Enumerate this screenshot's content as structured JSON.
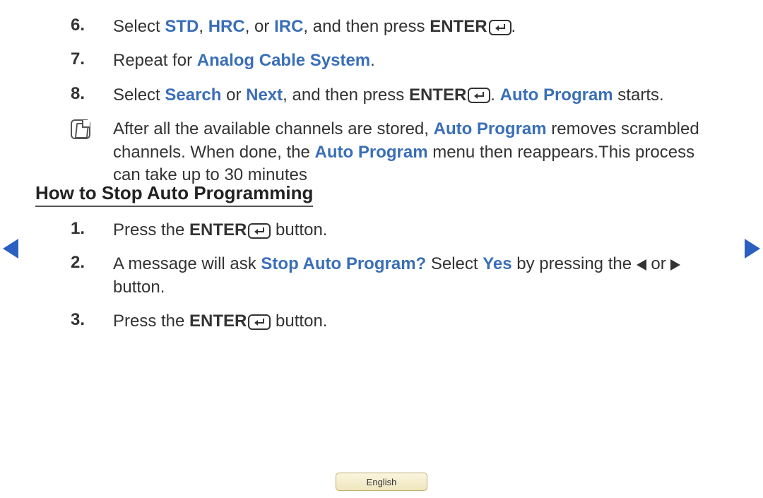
{
  "steps_a": [
    {
      "num": "6.",
      "parts": [
        {
          "t": "Select ",
          "c": ""
        },
        {
          "t": "STD",
          "c": "kw bold"
        },
        {
          "t": ", ",
          "c": ""
        },
        {
          "t": "HRC",
          "c": "kw bold"
        },
        {
          "t": ", or ",
          "c": ""
        },
        {
          "t": "IRC",
          "c": "kw bold"
        },
        {
          "t": ", and then press ",
          "c": ""
        },
        {
          "t": "ENTER",
          "c": "bold"
        },
        {
          "icon": "enter"
        },
        {
          "t": ".",
          "c": ""
        }
      ]
    },
    {
      "num": "7.",
      "parts": [
        {
          "t": "Repeat for ",
          "c": ""
        },
        {
          "t": "Analog Cable System",
          "c": "kw bold"
        },
        {
          "t": ".",
          "c": ""
        }
      ]
    },
    {
      "num": "8.",
      "parts": [
        {
          "t": "Select ",
          "c": ""
        },
        {
          "t": "Search",
          "c": "kw bold"
        },
        {
          "t": " or ",
          "c": ""
        },
        {
          "t": "Next",
          "c": "kw bold"
        },
        {
          "t": ", and then press ",
          "c": ""
        },
        {
          "t": "ENTER",
          "c": "bold"
        },
        {
          "icon": "enter"
        },
        {
          "t": ". ",
          "c": ""
        },
        {
          "t": "Auto Program",
          "c": "kw bold"
        },
        {
          "t": " starts.",
          "c": ""
        }
      ]
    }
  ],
  "note": {
    "parts": [
      {
        "t": "After all the available channels are stored, ",
        "c": ""
      },
      {
        "t": "Auto Program",
        "c": "kw bold"
      },
      {
        "t": " removes scrambled channels. When done, the ",
        "c": ""
      },
      {
        "t": "Auto Program",
        "c": "kw bold"
      },
      {
        "t": " menu then reappears.This process can take up to 30 minutes",
        "c": ""
      }
    ]
  },
  "heading": "How to Stop Auto Programming",
  "steps_b": [
    {
      "num": "1.",
      "parts": [
        {
          "t": "Press the ",
          "c": ""
        },
        {
          "t": "ENTER",
          "c": "bold"
        },
        {
          "icon": "enter"
        },
        {
          "t": " button.",
          "c": ""
        }
      ]
    },
    {
      "num": "2.",
      "parts": [
        {
          "t": "A message will ask ",
          "c": ""
        },
        {
          "t": "Stop Auto Program?",
          "c": "kw bold"
        },
        {
          "t": " Select ",
          "c": ""
        },
        {
          "t": "Yes",
          "c": "kw bold"
        },
        {
          "t": " by pressing the ",
          "c": ""
        },
        {
          "icon": "tri-left"
        },
        {
          "t": " or ",
          "c": ""
        },
        {
          "icon": "tri-right"
        },
        {
          "t": " button.",
          "c": ""
        }
      ]
    },
    {
      "num": "3.",
      "parts": [
        {
          "t": "Press the ",
          "c": ""
        },
        {
          "t": "ENTER",
          "c": "bold"
        },
        {
          "icon": "enter"
        },
        {
          "t": " button.",
          "c": ""
        }
      ]
    }
  ],
  "language_button": "English"
}
